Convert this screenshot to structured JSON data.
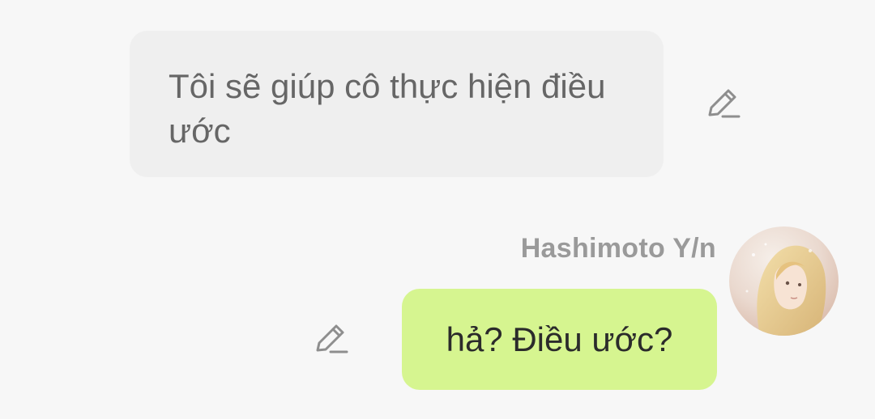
{
  "messages": [
    {
      "side": "left",
      "text": "Tôi sẽ giúp cô thực hiện điều ước",
      "icon": "pencil-edit-icon"
    },
    {
      "side": "right",
      "sender": "Hashimoto Y/n",
      "text": "hả? Điều ước?",
      "icon": "pencil-edit-icon",
      "avatar": "user-avatar"
    }
  ],
  "colors": {
    "background": "#f7f7f7",
    "left_bubble": "#efefef",
    "right_bubble": "#d6f590",
    "left_text": "#666666",
    "sender_name": "#9a9a9a"
  }
}
